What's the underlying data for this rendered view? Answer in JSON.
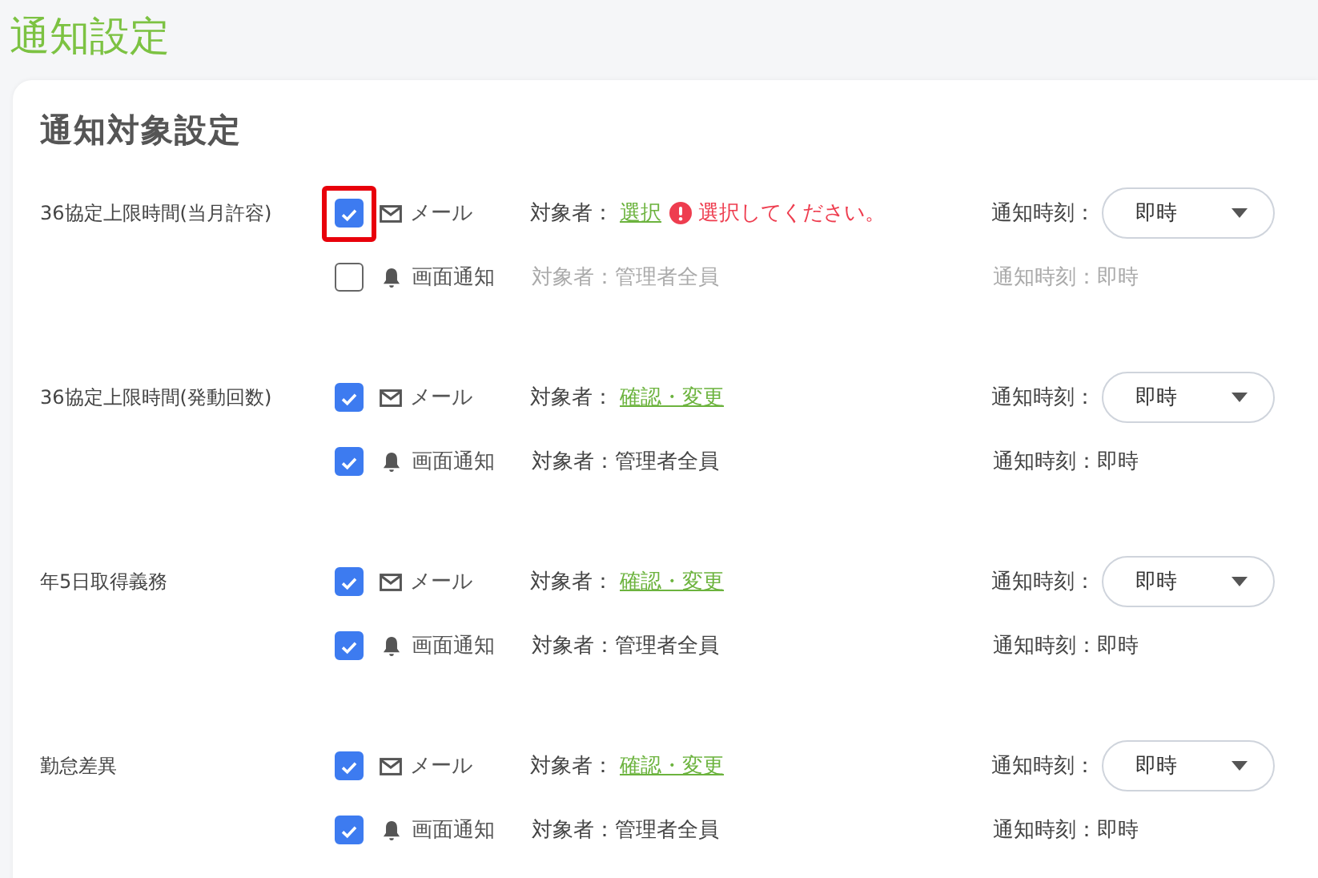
{
  "page_title": "通知設定",
  "card": {
    "heading": "通知対象設定",
    "groups": [
      {
        "name": "36協定上限時間(当月許容)",
        "channels": [
          {
            "kind": "mail",
            "checked": true,
            "focused": true,
            "label": "メール",
            "target_label": "対象者：",
            "target_link": "選択",
            "error": "選択してください。",
            "time_label": "通知時刻：",
            "time_value": "即時"
          },
          {
            "kind": "screen",
            "checked": false,
            "focused": false,
            "label": "画面通知",
            "target": "対象者：管理者全員",
            "time": "通知時刻：即時"
          }
        ]
      },
      {
        "name": "36協定上限時間(発動回数)",
        "channels": [
          {
            "kind": "mail",
            "checked": true,
            "focused": false,
            "label": "メール",
            "target_label": "対象者：",
            "target_link": "確認・変更",
            "time_label": "通知時刻：",
            "time_value": "即時"
          },
          {
            "kind": "screen",
            "checked": true,
            "focused": false,
            "label": "画面通知",
            "target": "対象者：管理者全員",
            "time": "通知時刻：即時"
          }
        ]
      },
      {
        "name": "年5日取得義務",
        "channels": [
          {
            "kind": "mail",
            "checked": true,
            "focused": false,
            "label": "メール",
            "target_label": "対象者：",
            "target_link": "確認・変更",
            "time_label": "通知時刻：",
            "time_value": "即時"
          },
          {
            "kind": "screen",
            "checked": true,
            "focused": false,
            "label": "画面通知",
            "target": "対象者：管理者全員",
            "time": "通知時刻：即時"
          }
        ]
      },
      {
        "name": "勤怠差異",
        "channels": [
          {
            "kind": "mail",
            "checked": true,
            "focused": false,
            "label": "メール",
            "target_label": "対象者：",
            "target_link": "確認・変更",
            "time_label": "通知時刻：",
            "time_value": "即時"
          },
          {
            "kind": "screen",
            "checked": true,
            "focused": false,
            "label": "画面通知",
            "target": "対象者：管理者全員",
            "time": "通知時刻：即時"
          }
        ]
      }
    ]
  }
}
